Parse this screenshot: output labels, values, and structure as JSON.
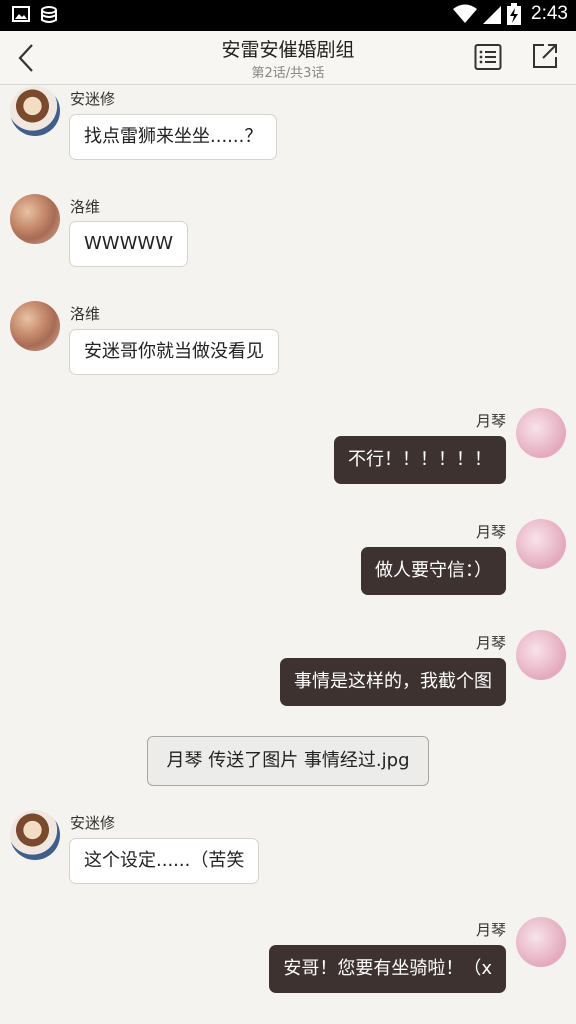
{
  "statusbar": {
    "time": "2:43"
  },
  "header": {
    "title": "安雷安催婚剧组",
    "subtitle": "第2话/共3话"
  },
  "messages": [
    {
      "side": "left",
      "name": "安迷修",
      "text": "找点雷狮来坐坐......？",
      "avatar": "anime-avatar"
    },
    {
      "side": "left",
      "name": "洛维",
      "text": "WWWWW",
      "avatar": "brown-avatar"
    },
    {
      "side": "left",
      "name": "洛维",
      "text": "安迷哥你就当做没看见",
      "avatar": "brown-avatar"
    },
    {
      "side": "right",
      "name": "月琴",
      "text": "不行！！！！！！",
      "avatar": "pink-avatar"
    },
    {
      "side": "right",
      "name": "月琴",
      "text": "做人要守信：）",
      "avatar": "pink-avatar"
    },
    {
      "side": "right",
      "name": "月琴",
      "text": "事情是这样的，我截个图",
      "avatar": "pink-avatar"
    },
    {
      "side": "system",
      "text": "月琴 传送了图片 事情经过.jpg"
    },
    {
      "side": "left",
      "name": "安迷修",
      "text": "这个设定......（苦笑",
      "avatar": "anime-avatar"
    },
    {
      "side": "right",
      "name": "月琴",
      "text": "安哥！您要有坐骑啦！（x",
      "avatar": "pink-avatar"
    }
  ],
  "colors": {
    "background": "#f4f3ef",
    "right_bubble": "#3e3231",
    "left_bubble": "#ffffff"
  }
}
